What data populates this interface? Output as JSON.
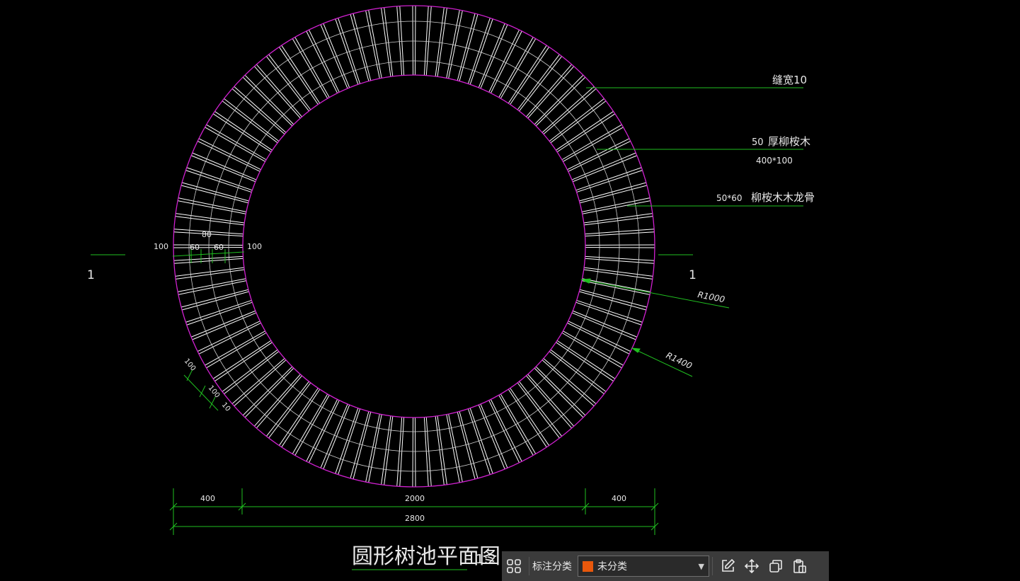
{
  "drawing": {
    "title": "圆形树池平面图",
    "scale": "1:2",
    "section_mark_left": "1",
    "section_mark_right": "1",
    "annotations": {
      "joint": "缝宽10",
      "plank_thickness": "50",
      "plank_material": "厚柳桉木",
      "plank_size": "400*100",
      "joist_size": "50*60",
      "joist_material": "柳桉木木龙骨"
    },
    "radii": {
      "inner": "R1000",
      "outer": "R1400"
    },
    "dims_left_section": {
      "left": "100",
      "mid_top": "80",
      "a": "60",
      "b": "60",
      "right": "100"
    },
    "dims_bottom_left": {
      "a": "100",
      "b": "100",
      "c": "10"
    },
    "dims_bottom": {
      "left": "400",
      "middle": "2000",
      "right": "400",
      "total": "2800"
    },
    "colors": {
      "circle": "#d020d0",
      "leader": "#20c020",
      "planks": "#ffffff",
      "grid": "#cfcfcf"
    }
  },
  "toolbar": {
    "grid_icon": "grid-icon",
    "label": "标注分类",
    "select_value": "未分类",
    "select_color": "#e8580c",
    "edit_icon": "edit-icon",
    "move_icon": "move-icon",
    "copy_icon": "copy-icon",
    "paste_icon": "paste-icon"
  }
}
